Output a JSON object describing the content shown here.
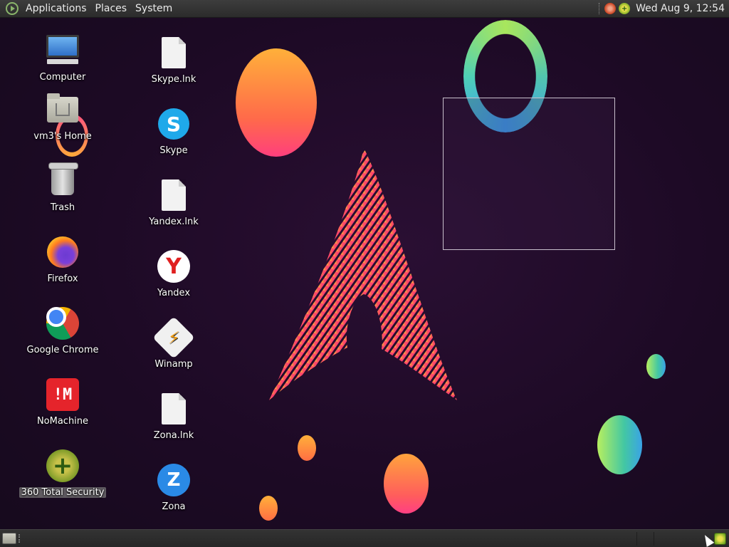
{
  "top_panel": {
    "menus": [
      "Applications",
      "Places",
      "System"
    ],
    "clock": "Wed Aug  9, 12:54"
  },
  "desktop": {
    "column1": [
      {
        "label": "Computer",
        "icon": "computer-icon"
      },
      {
        "label": "vm3's Home",
        "icon": "home-folder-icon"
      },
      {
        "label": "Trash",
        "icon": "trash-icon"
      },
      {
        "label": "Firefox",
        "icon": "firefox-icon"
      },
      {
        "label": "Google Chrome",
        "icon": "chrome-icon"
      },
      {
        "label": "NoMachine",
        "icon": "nomachine-icon"
      },
      {
        "label": "360 Total Security",
        "icon": "360-total-security-icon"
      }
    ],
    "column2": [
      {
        "label": "Skype.lnk",
        "icon": "document-icon"
      },
      {
        "label": "Skype",
        "icon": "skype-icon"
      },
      {
        "label": "Yandex.lnk",
        "icon": "document-icon"
      },
      {
        "label": "Yandex",
        "icon": "yandex-icon"
      },
      {
        "label": "Winamp",
        "icon": "winamp-icon"
      },
      {
        "label": "Zona.lnk",
        "icon": "document-icon"
      },
      {
        "label": "Zona",
        "icon": "zona-icon"
      }
    ]
  },
  "glyphs": {
    "nomachine": "!M",
    "skype": "S",
    "yandex": "Y",
    "winamp": "⚡",
    "zona": "Z",
    "total360": "+"
  },
  "colors": {
    "wallpaper": "#1d0a25",
    "panel": "#2f2f2f",
    "accent_orange": "#ff7a3c",
    "accent_green": "#a8e65d"
  }
}
